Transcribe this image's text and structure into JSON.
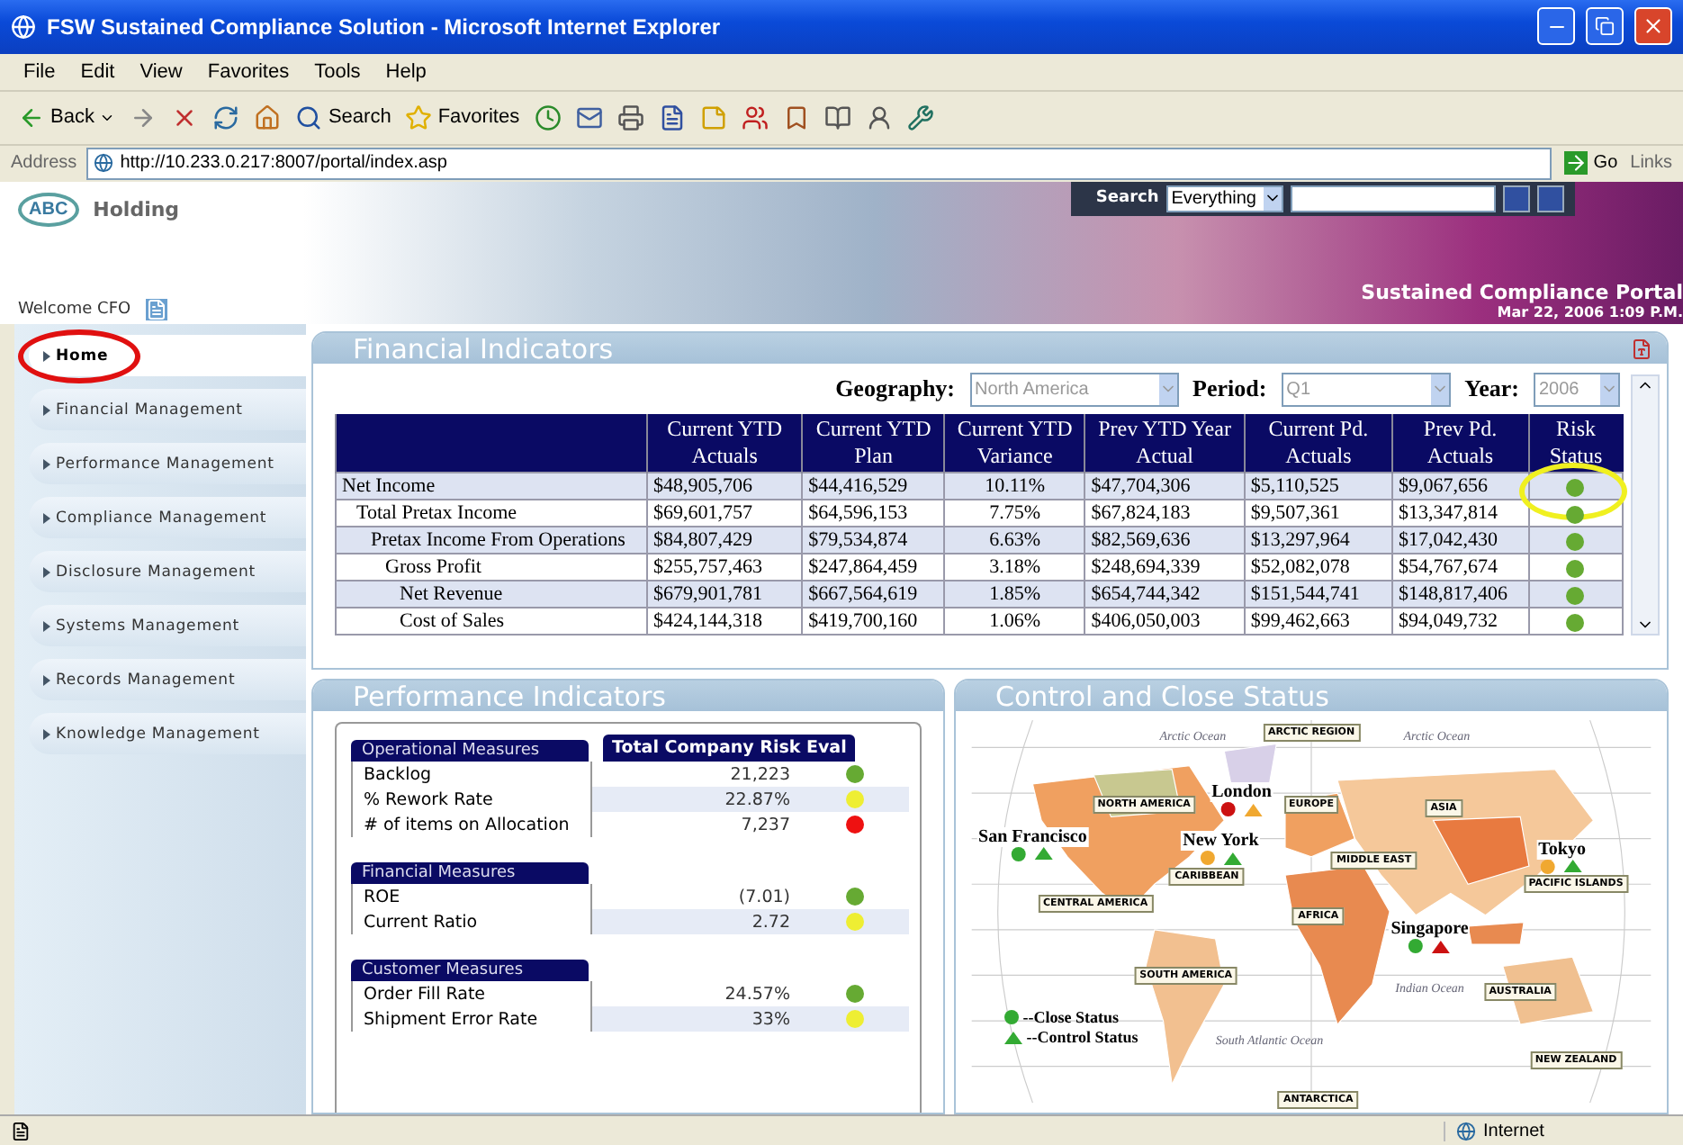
{
  "window": {
    "title": "FSW Sustained Compliance Solution - Microsoft Internet Explorer"
  },
  "menu": [
    "File",
    "Edit",
    "View",
    "Favorites",
    "Tools",
    "Help"
  ],
  "toolbar": [
    {
      "kind": "back",
      "label": "Back"
    },
    {
      "kind": "forward"
    },
    {
      "kind": "stop"
    },
    {
      "kind": "refresh"
    },
    {
      "kind": "home"
    },
    {
      "kind": "search",
      "label": "Search"
    },
    {
      "kind": "favorites",
      "label": "Favorites"
    },
    {
      "kind": "history"
    },
    {
      "kind": "mail"
    },
    {
      "kind": "print"
    },
    {
      "kind": "edit"
    },
    {
      "kind": "note"
    },
    {
      "kind": "messenger"
    },
    {
      "kind": "bookmark"
    },
    {
      "kind": "research"
    },
    {
      "kind": "people"
    },
    {
      "kind": "tool"
    }
  ],
  "address": {
    "label": "Address",
    "url": "http://10.233.0.217:8007/portal/index.asp",
    "go": "Go",
    "links": "Links"
  },
  "header": {
    "logo": "ABC",
    "company": "Holding",
    "welcome": "Welcome CFO",
    "search_label": "Search",
    "search_scope": "Everything",
    "portal_title": "Sustained Compliance Portal",
    "datetime": "Mar 22, 2006 1:09 P.M."
  },
  "nav": [
    {
      "label": "Home",
      "selected": true
    },
    {
      "label": "Financial Management",
      "selected": false
    },
    {
      "label": "Performance Management",
      "selected": false
    },
    {
      "label": "Compliance Management",
      "selected": false
    },
    {
      "label": "Disclosure Management",
      "selected": false
    },
    {
      "label": "Systems Management",
      "selected": false
    },
    {
      "label": "Records Management",
      "selected": false
    },
    {
      "label": "Knowledge Management",
      "selected": false
    }
  ],
  "financial": {
    "title": "Financial Indicators",
    "filters": [
      {
        "label": "Geography:",
        "value": "North America",
        "disabled": true
      },
      {
        "label": "Period:",
        "value": "Q1",
        "disabled": true
      },
      {
        "label": "Year:",
        "value": "2006",
        "disabled": true
      }
    ],
    "columns": [
      "Current YTD Actuals",
      "Current YTD Plan",
      "Current YTD Variance",
      "Prev YTD Year Actual",
      "Current Pd. Actuals",
      "Prev Pd. Actuals",
      "Risk Status"
    ],
    "rows": [
      {
        "label": "Net Income",
        "values": [
          "$48,905,706",
          "$44,416,529",
          "10.11%",
          "$47,704,306",
          "$5,110,525",
          "$9,067,656"
        ],
        "color": "#66aa33",
        "children": [
          {
            "label": "Total Pretax Income",
            "values": [
              "$69,601,757",
              "$64,596,153",
              "7.75%",
              "$67,824,183",
              "$9,507,361",
              "$13,347,814"
            ],
            "color": "#66aa33",
            "children": [
              {
                "label": "Pretax Income From Operations",
                "values": [
                  "$84,807,429",
                  "$79,534,874",
                  "6.63%",
                  "$82,569,636",
                  "$13,297,964",
                  "$17,042,430"
                ],
                "color": "#66aa33",
                "children": [
                  {
                    "label": "Gross Profit",
                    "values": [
                      "$255,757,463",
                      "$247,864,459",
                      "3.18%",
                      "$248,694,339",
                      "$52,082,078",
                      "$54,767,674"
                    ],
                    "color": "#66aa33",
                    "children": [
                      {
                        "label": "Net Revenue",
                        "values": [
                          "$679,901,781",
                          "$667,564,619",
                          "1.85%",
                          "$654,744,342",
                          "$151,544,741",
                          "$148,817,406"
                        ],
                        "color": "#66aa33"
                      },
                      {
                        "label": "Cost of Sales",
                        "values": [
                          "$424,144,318",
                          "$419,700,160",
                          "1.06%",
                          "$406,050,003",
                          "$99,462,663",
                          "$94,049,732"
                        ],
                        "color": "#66aa33"
                      }
                    ]
                  }
                ]
              }
            ]
          }
        ]
      }
    ]
  },
  "performance": {
    "title": "Performance Indicators",
    "eval_header": "Total Company Risk Eval",
    "groups": [
      {
        "title": "Operational Measures",
        "rows": [
          {
            "label": "Backlog",
            "value": "21,223",
            "color": "#66aa33"
          },
          {
            "label": "% Rework Rate",
            "value": "22.87%",
            "color": "#eeee33"
          },
          {
            "label": "# of items on Allocation",
            "value": "7,237",
            "color": "#ee1111"
          }
        ]
      },
      {
        "title": "Financial Measures",
        "rows": [
          {
            "label": "ROE",
            "value": "(7.01)",
            "color": "#66aa33"
          },
          {
            "label": "Current Ratio",
            "value": "2.72",
            "color": "#eeee33"
          }
        ]
      },
      {
        "title": "Customer Measures",
        "rows": [
          {
            "label": "Order Fill Rate",
            "value": "24.57%",
            "color": "#66aa33"
          },
          {
            "label": "Shipment Error Rate",
            "value": "33%",
            "color": "#eeee33"
          }
        ]
      }
    ]
  },
  "map": {
    "title": "Control and Close Status",
    "regions": [
      "ARCTIC REGION",
      "NORTH AMERICA",
      "EUROPE",
      "ASIA",
      "CARIBBEAN",
      "MIDDLE EAST",
      "CENTRAL AMERICA",
      "AFRICA",
      "PACIFIC ISLANDS",
      "SOUTH AMERICA",
      "AUSTRALIA",
      "NEW ZEALAND",
      "ANTARCTICA"
    ],
    "oceans": [
      "Arctic Ocean",
      "Arctic Ocean",
      "Indian Ocean",
      "South Atlantic Ocean"
    ],
    "cities": [
      {
        "name": "San Francisco",
        "markers": [
          {
            "kind": "close",
            "color": "#33aa33"
          },
          {
            "kind": "control",
            "color": "#33aa33"
          }
        ]
      },
      {
        "name": "New York",
        "markers": [
          {
            "kind": "close",
            "color": "#f0a830"
          },
          {
            "kind": "control",
            "color": "#33aa33"
          }
        ]
      },
      {
        "name": "London",
        "markers": [
          {
            "kind": "close",
            "color": "#cc1111"
          },
          {
            "kind": "control",
            "color": "#f0a830"
          }
        ]
      },
      {
        "name": "Singapore",
        "markers": [
          {
            "kind": "close",
            "color": "#33aa33"
          },
          {
            "kind": "control",
            "color": "#cc1111"
          }
        ]
      },
      {
        "name": "Tokyo",
        "markers": [
          {
            "kind": "close",
            "color": "#f0a830"
          },
          {
            "kind": "control",
            "color": "#33aa33"
          }
        ]
      }
    ],
    "legend": [
      "--Close Status",
      "--Control Status"
    ]
  },
  "status_bar": {
    "zone": "Internet"
  }
}
